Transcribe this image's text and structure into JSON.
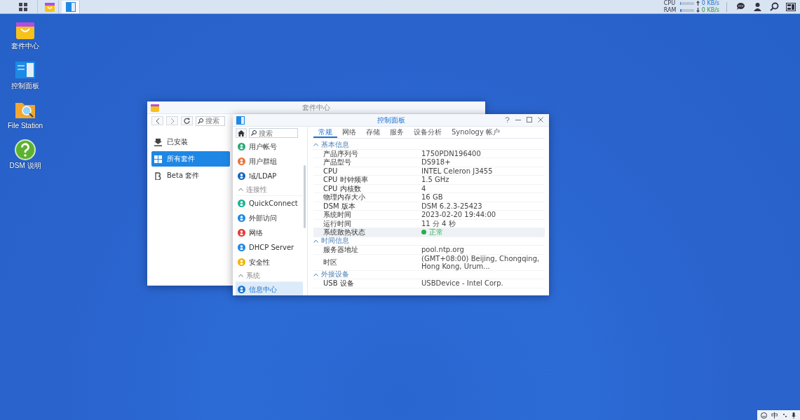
{
  "taskbar": {
    "apps": [
      {
        "selected": false
      },
      {
        "selected": true
      }
    ],
    "monitor": [
      {
        "label": "CPU",
        "level": 0.06,
        "speed": "0 KB/s"
      },
      {
        "label": "RAM",
        "level": 0.12,
        "speed": "0 KB/s"
      }
    ]
  },
  "desktop_icons": [
    {
      "label": "套件中心"
    },
    {
      "label": "控制面板"
    },
    {
      "label": "File Station"
    },
    {
      "label": "DSM 说明"
    }
  ],
  "package_center": {
    "title": "套件中心",
    "search": {
      "placeholder": "搜索"
    },
    "sidebar": [
      {
        "label": "已安装",
        "selected": false
      },
      {
        "label": "所有套件",
        "selected": true
      },
      {
        "label": "Beta 套件",
        "selected": false
      }
    ]
  },
  "control_panel": {
    "title": "控制面板",
    "search": {
      "placeholder": "搜索"
    },
    "sidebar": [
      {
        "kind": "item",
        "label": "用户帐号",
        "selected": false
      },
      {
        "kind": "item",
        "label": "用户群组",
        "selected": false
      },
      {
        "kind": "item",
        "label": "域/LDAP",
        "selected": false
      },
      {
        "kind": "section",
        "label": "连接性",
        "expanded": true
      },
      {
        "kind": "item",
        "label": "QuickConnect",
        "selected": false
      },
      {
        "kind": "item",
        "label": "外部访问",
        "selected": false
      },
      {
        "kind": "item",
        "label": "网络",
        "selected": false
      },
      {
        "kind": "item",
        "label": "DHCP Server",
        "selected": false
      },
      {
        "kind": "item",
        "label": "安全性",
        "selected": false
      },
      {
        "kind": "section",
        "label": "系统",
        "expanded": true
      },
      {
        "kind": "item",
        "label": "信息中心",
        "selected": true
      }
    ],
    "tabs": [
      {
        "label": "常规",
        "selected": true
      },
      {
        "label": "网络",
        "selected": false
      },
      {
        "label": "存储",
        "selected": false
      },
      {
        "label": "服务",
        "selected": false
      },
      {
        "label": "设备分析",
        "selected": false
      },
      {
        "label": "Synology 帐户",
        "selected": false
      }
    ],
    "sections": [
      {
        "title": "基本信息",
        "expanded": true,
        "rows": [
          {
            "kind": "text",
            "label": "产品序列号",
            "value": "1750PDN196400",
            "selected": false
          },
          {
            "kind": "text",
            "label": "产品型号",
            "value": "DS918+",
            "selected": false
          },
          {
            "kind": "text",
            "label": "CPU",
            "value": "INTEL Celeron J3455",
            "selected": false
          },
          {
            "kind": "text",
            "label": "CPU 时钟频率",
            "value": "1.5 GHz",
            "selected": false
          },
          {
            "kind": "text",
            "label": "CPU 内核数",
            "value": "4",
            "selected": false
          },
          {
            "kind": "text",
            "label": "物理内存大小",
            "value": "16 GB",
            "selected": false
          },
          {
            "kind": "text",
            "label": "DSM 版本",
            "value": "DSM 6.2.3-25423",
            "selected": false
          },
          {
            "kind": "text",
            "label": "系统时间",
            "value": "2023-02-20 19:44:00",
            "selected": false
          },
          {
            "kind": "text",
            "label": "运行时间",
            "value": "11 分 4 秒",
            "selected": false
          },
          {
            "kind": "status",
            "label": "系统散热状态",
            "value": "正常",
            "color": "#22b14c",
            "selected": true
          }
        ]
      },
      {
        "title": "时间信息",
        "expanded": true,
        "rows": [
          {
            "kind": "text",
            "label": "服务器地址",
            "value": "pool.ntp.org",
            "selected": false
          },
          {
            "kind": "text",
            "label": "时区",
            "value": "(GMT+08:00) Beijing, Chongqing, Hong Kong, Urum...",
            "selected": false
          }
        ]
      },
      {
        "title": "外接设备",
        "expanded": true,
        "rows": [
          {
            "kind": "text",
            "label": "USB 设备",
            "value": "USBDevice - Intel Corp.",
            "selected": false
          }
        ]
      }
    ]
  },
  "tray": {
    "ime": "中"
  }
}
